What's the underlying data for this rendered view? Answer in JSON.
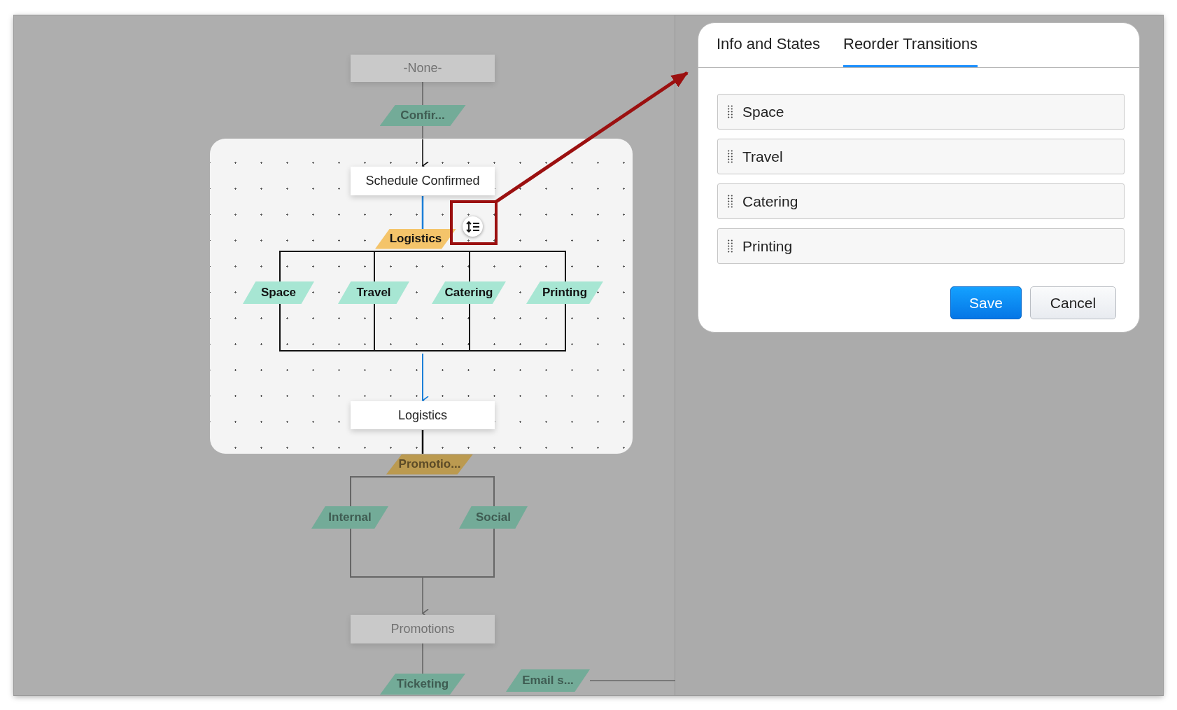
{
  "canvas": {
    "nodes": [
      {
        "kind": "state",
        "label": "-None-",
        "focused": false
      },
      {
        "kind": "transition",
        "label": "Confir...",
        "focused": false
      },
      {
        "kind": "state",
        "label": "Schedule Confirmed",
        "focused": true
      },
      {
        "kind": "parent_transition",
        "label": "Logistics",
        "focused": true
      },
      {
        "kind": "transition",
        "label": "Space",
        "focused": true
      },
      {
        "kind": "transition",
        "label": "Travel",
        "focused": true
      },
      {
        "kind": "transition",
        "label": "Catering",
        "focused": true
      },
      {
        "kind": "transition",
        "label": "Printing",
        "focused": true
      },
      {
        "kind": "state",
        "label": "Logistics",
        "focused": true
      },
      {
        "kind": "parent_transition",
        "label": "Promotio...",
        "focused": false
      },
      {
        "kind": "transition",
        "label": "Internal",
        "focused": false
      },
      {
        "kind": "transition",
        "label": "Social",
        "focused": false
      },
      {
        "kind": "state",
        "label": "Promotions",
        "focused": false
      },
      {
        "kind": "transition",
        "label": "Email s...",
        "focused": false
      },
      {
        "kind": "transition",
        "label": "Ticketing",
        "focused": false
      }
    ]
  },
  "dialog": {
    "tabs": [
      {
        "label": "Info and States",
        "selected": false
      },
      {
        "label": "Reorder Transitions",
        "selected": true
      }
    ],
    "items": [
      {
        "label": "Space"
      },
      {
        "label": "Travel"
      },
      {
        "label": "Catering"
      },
      {
        "label": "Printing"
      }
    ],
    "buttons": [
      {
        "label": "Save",
        "kind": "primary"
      },
      {
        "label": "Cancel",
        "kind": "secondary"
      }
    ]
  }
}
